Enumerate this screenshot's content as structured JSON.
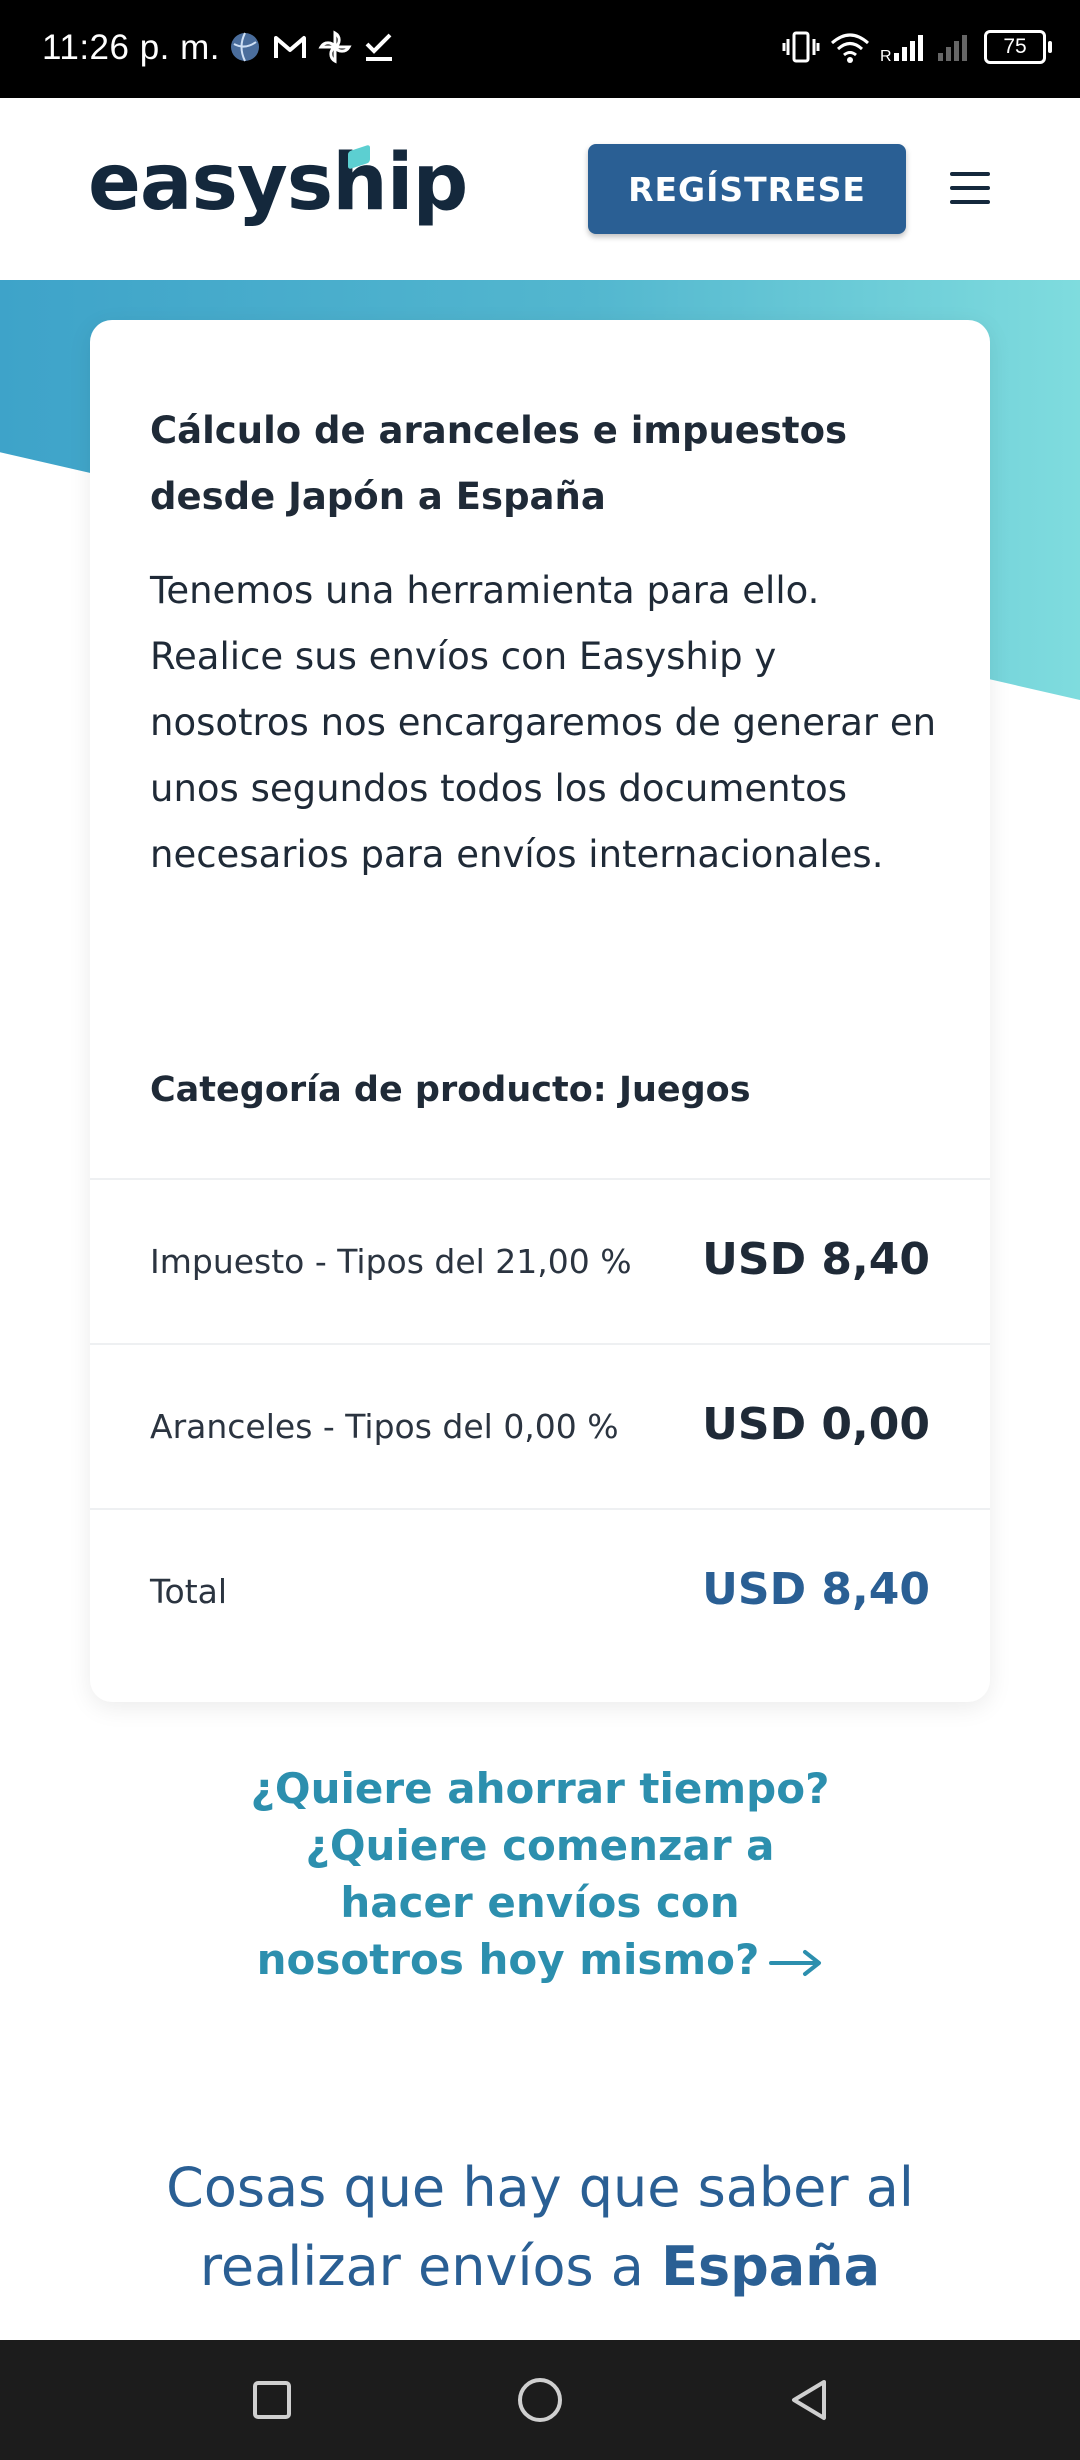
{
  "status_bar": {
    "time": "11:26 p. m.",
    "battery": "75",
    "left_icons": [
      "globe-icon",
      "gmail-icon",
      "pinwheel-icon",
      "check-icon"
    ],
    "right_icons": [
      "vibrate-icon",
      "wifi-icon",
      "signal-icon",
      "signal-icon",
      "battery-icon"
    ]
  },
  "header": {
    "logo": "easyship",
    "register_label": "REGÍSTRESE",
    "menu_icon": "hamburger-menu-icon"
  },
  "colors": {
    "brand": "#2a5f94",
    "accent": "#2c8fae",
    "banner_start": "#3ea3c9",
    "banner_end": "#7fdcde"
  },
  "card": {
    "title": "Cálculo de aranceles e impuestos desde Japón a España",
    "description": "Tenemos una herramienta para ello. Realice sus envíos con Easyship y nosotros nos encargaremos de generar en unos segundos todos los documentos necesarios para envíos internacionales.",
    "category": "Categoría de producto: Juegos",
    "rows": [
      {
        "label": "Impuesto - Tipos del 21,00 %",
        "value": "USD 8,40"
      },
      {
        "label": "Aranceles - Tipos del 0,00 %",
        "value": "USD 0,00"
      },
      {
        "label": "Total",
        "value": "USD 8,40"
      }
    ]
  },
  "cta": {
    "line1": "¿Quiere ahorrar tiempo?",
    "line2": "¿Quiere comenzar a",
    "line3": "hacer envíos con",
    "line4": "nosotros hoy mismo?",
    "arrow_icon": "arrow-right-icon"
  },
  "things": {
    "text_before": "Cosas que hay que saber al realizar envíos a",
    "country": "España"
  },
  "nav_bar": {
    "buttons": [
      "recent-apps-icon",
      "home-icon",
      "back-icon"
    ]
  }
}
